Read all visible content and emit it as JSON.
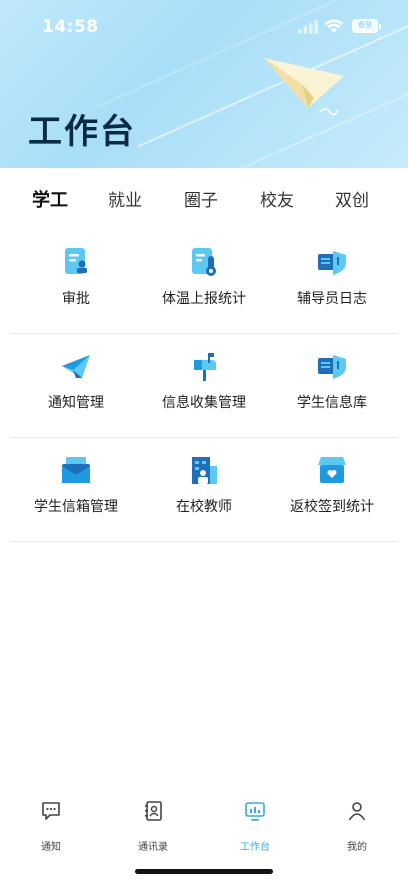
{
  "status_bar": {
    "time": "14:58",
    "battery": "69"
  },
  "header": {
    "title": "工作台"
  },
  "tabs": [
    {
      "label": "学工",
      "active": true
    },
    {
      "label": "就业",
      "active": false
    },
    {
      "label": "圈子",
      "active": false
    },
    {
      "label": "校友",
      "active": false
    },
    {
      "label": "双创",
      "active": false
    }
  ],
  "grid": [
    {
      "label": "审批",
      "icon": "approval-icon"
    },
    {
      "label": "体温上报统计",
      "icon": "thermometer-report-icon"
    },
    {
      "label": "辅导员日志",
      "icon": "shield-log-icon"
    },
    {
      "label": "通知管理",
      "icon": "paper-plane-icon"
    },
    {
      "label": "信息收集管理",
      "icon": "mailbox-icon"
    },
    {
      "label": "学生信息库",
      "icon": "shield-database-icon"
    },
    {
      "label": "学生信箱管理",
      "icon": "envelope-icon"
    },
    {
      "label": "在校教师",
      "icon": "building-teacher-icon"
    },
    {
      "label": "返校签到统计",
      "icon": "store-checkin-icon"
    }
  ],
  "bottom_nav": [
    {
      "label": "通知",
      "icon": "message-icon",
      "active": false
    },
    {
      "label": "通讯录",
      "icon": "contacts-icon",
      "active": false
    },
    {
      "label": "工作台",
      "icon": "workbench-icon",
      "active": true
    },
    {
      "label": "我的",
      "icon": "person-icon",
      "active": false
    }
  ],
  "colors": {
    "accent": "#3aa7e6",
    "icon_primary": "#1e9be0",
    "icon_light": "#5cc9f2",
    "header_bg": "#b8e4fa"
  }
}
